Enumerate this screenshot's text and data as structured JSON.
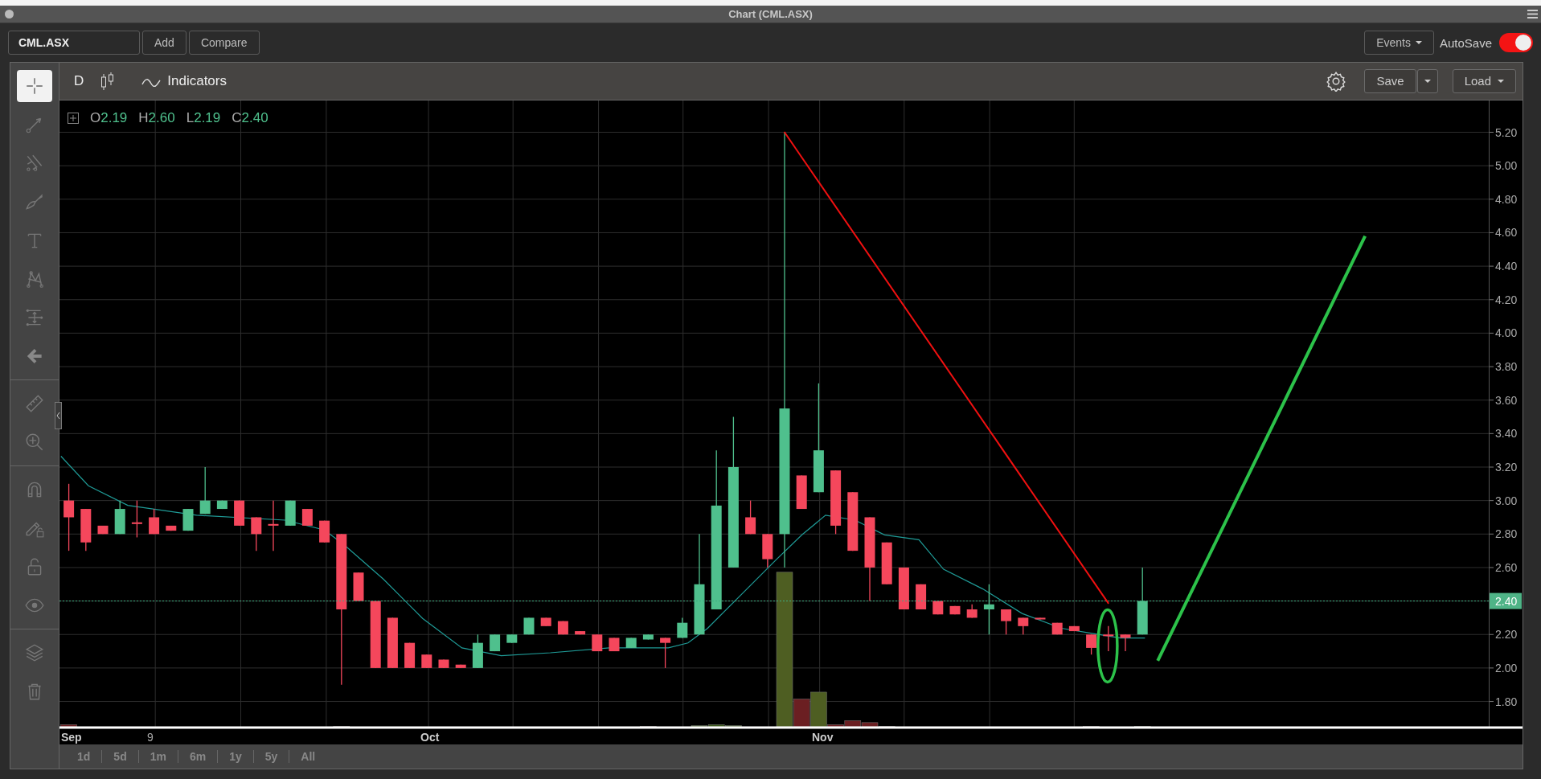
{
  "window": {
    "title": "Chart (CML.ASX)"
  },
  "toolbar": {
    "symbol": "CML.ASX",
    "buttons": [
      "Add",
      "Compare"
    ],
    "events": "Events",
    "autosave": {
      "label": "AutoSave",
      "on": true
    }
  },
  "tools": [
    {
      "kind": "crosshair",
      "selected": true
    },
    {
      "kind": "line",
      "selected": false
    },
    {
      "kind": "channel",
      "selected": false
    },
    {
      "kind": "brush",
      "selected": false
    },
    {
      "kind": "text",
      "selected": false
    },
    {
      "kind": "pattern",
      "selected": false
    },
    {
      "kind": "fib",
      "selected": false
    },
    {
      "kind": "back",
      "selected": false
    },
    {
      "kind": "ruler",
      "selected": false
    },
    {
      "kind": "zoom",
      "selected": false
    },
    {
      "kind": "magnet",
      "selected": false
    },
    {
      "kind": "lockdraw",
      "selected": false
    },
    {
      "kind": "lock",
      "selected": false
    },
    {
      "kind": "eye",
      "selected": false
    },
    {
      "kind": "layers",
      "selected": false
    },
    {
      "kind": "trash",
      "selected": false
    }
  ],
  "chart_header": {
    "period": "D",
    "indicators": "Indicators",
    "save": "Save",
    "load": "Load"
  },
  "ohlc": [
    {
      "label": "O",
      "value": "2.19"
    },
    {
      "label": "H",
      "value": "2.60"
    },
    {
      "label": "L",
      "value": "2.19"
    },
    {
      "label": "C",
      "value": "2.40"
    }
  ],
  "price_axis": [
    "5.20",
    "5.00",
    "4.80",
    "4.60",
    "4.40",
    "4.20",
    "4.00",
    "3.80",
    "3.60",
    "3.40",
    "3.20",
    "3.00",
    "2.80",
    "2.60",
    "2.20",
    "2.00",
    "1.80"
  ],
  "current_price": "2.40",
  "date_axis": [
    "Sep",
    "9",
    "Oct",
    "Nov"
  ],
  "ranges": [
    {
      "label": "1d",
      "selected": false
    },
    {
      "label": "5d",
      "selected": false
    },
    {
      "label": "1m",
      "selected": false
    },
    {
      "label": "6m",
      "selected": false
    },
    {
      "label": "1y",
      "selected": false
    },
    {
      "label": "5y",
      "selected": false
    },
    {
      "label": "All",
      "selected": false
    }
  ]
}
